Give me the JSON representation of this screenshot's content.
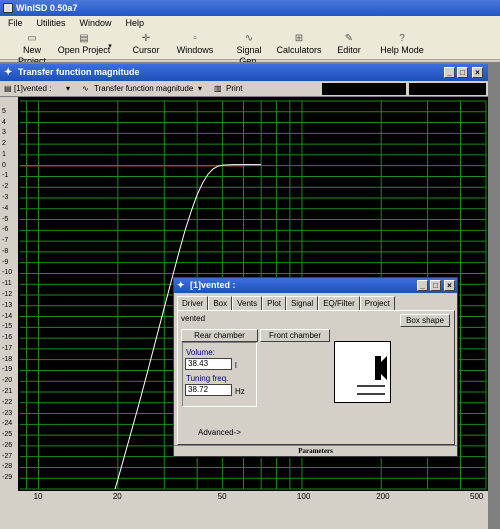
{
  "app": {
    "title": "WinISD 0.50a7"
  },
  "menu": [
    "File",
    "Utilities",
    "Window",
    "Help"
  ],
  "toolbar": [
    {
      "name": "new-project",
      "label": "New Project",
      "icon": "new-file-icon"
    },
    {
      "name": "open-project",
      "label": "Open Project",
      "icon": "folder-icon"
    },
    {
      "name": "cursor",
      "label": "Cursor",
      "icon": "cursor-icon"
    },
    {
      "name": "windows",
      "label": "Windows",
      "icon": "windows-icon"
    },
    {
      "name": "signal-gen",
      "label": "Signal Gen.",
      "icon": "sine-wave-icon"
    },
    {
      "name": "calculators",
      "label": "Calculators",
      "icon": "calculator-icon"
    },
    {
      "name": "editor",
      "label": "Editor",
      "icon": "editor-icon"
    },
    {
      "name": "help-mode",
      "label": "Help Mode",
      "icon": "question-icon"
    }
  ],
  "graph_window": {
    "title": "Transfer function magnitude",
    "project_select": "[1]vented :",
    "graph_select": "Transfer function magnitude",
    "print_label": "Print"
  },
  "chart_data": {
    "type": "line",
    "x_scale": "log",
    "xlim": [
      8.5,
      500
    ],
    "ylim": [
      -30,
      6
    ],
    "x_ticks": [
      "10",
      "20",
      "50",
      "100",
      "200",
      "500"
    ],
    "y_ticks": [
      "5",
      "4",
      "3",
      "2",
      "1",
      "0",
      "-1",
      "-2",
      "-3",
      "-4",
      "-5",
      "-6",
      "-7",
      "-8",
      "-9",
      "-10",
      "-11",
      "-12",
      "-13",
      "-14",
      "-15",
      "-16",
      "-17",
      "-18",
      "-19",
      "-20",
      "-21",
      "-22",
      "-23",
      "-24",
      "-25",
      "-26",
      "-27",
      "-28",
      "-29"
    ],
    "grid": true,
    "reference_line_y": 0,
    "series": [
      {
        "color": "#ffffff",
        "x": [
          19.5,
          20,
          22,
          24,
          26,
          28,
          30,
          32,
          34,
          36,
          38,
          40,
          42,
          44,
          46,
          48,
          50,
          55,
          60,
          70
        ],
        "y": [
          -30,
          -29.1,
          -25.5,
          -22.2,
          -19.0,
          -16.0,
          -13.2,
          -10.6,
          -8.2,
          -6.0,
          -4.2,
          -2.7,
          -1.6,
          -0.8,
          -0.3,
          -0.05,
          0.05,
          0.1,
          0.1,
          0.1
        ]
      }
    ],
    "colors": {
      "background": "#000000",
      "grid": "#1f8a1f",
      "zero_line": "#cc3333",
      "curve": "#ffffff"
    }
  },
  "dialog": {
    "title": "[1]vented :",
    "tabs": [
      "Driver",
      "Box",
      "Vents",
      "Plot",
      "Signal",
      "EQ/Filter",
      "Project"
    ],
    "active_tab": "Box",
    "name_value": "vented",
    "box_shape_button": "Box shape",
    "rear_chamber_button": "Rear chamber",
    "front_chamber_button": "Front chamber",
    "volume_label": "Volume:",
    "volume_value": "38.43",
    "volume_unit": "l",
    "tuning_label": "Tuning freq.",
    "tuning_value": "38.72",
    "tuning_unit": "Hz",
    "advanced_label": "Advanced->",
    "status": "Parameters"
  }
}
